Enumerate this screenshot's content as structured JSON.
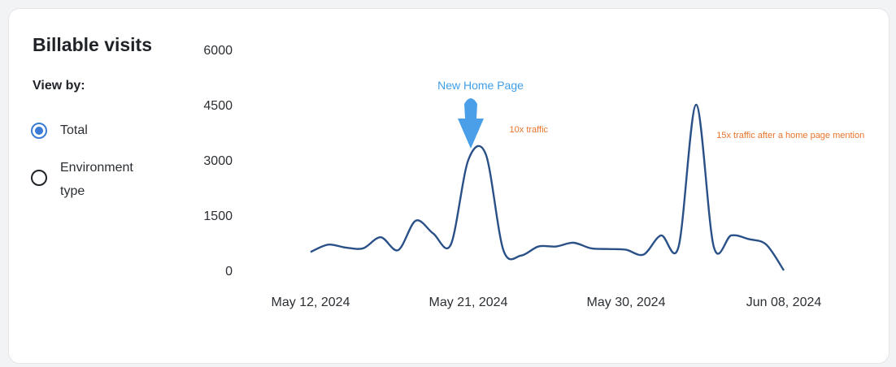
{
  "panel": {
    "title": "Billable visits",
    "view_by_label": "View by:",
    "options": [
      {
        "label": "Total",
        "selected": true
      },
      {
        "label": "Environment\ntype",
        "selected": false
      }
    ]
  },
  "colors": {
    "line": "#2a5088",
    "arrow": "#4a9fe8",
    "home_page_annotation": "#3f9ee8",
    "traffic_annotation": "#e8742c",
    "radio_selected": "#3a7bd5"
  },
  "chart_data": {
    "type": "line",
    "title": "Billable visits",
    "xlabel": "",
    "ylabel": "",
    "ylim": [
      0,
      6000
    ],
    "yticks": [
      0,
      1500,
      3000,
      4500,
      6000
    ],
    "xticks": [
      {
        "value": "2024-05-12",
        "label": "May 12, 2024"
      },
      {
        "value": "2024-05-21",
        "label": "May 21, 2024"
      },
      {
        "value": "2024-05-30",
        "label": "May 30, 2024"
      },
      {
        "value": "2024-06-08",
        "label": "Jun 08, 2024"
      }
    ],
    "grid": false,
    "legend": "none",
    "series": [
      {
        "x": [
          "2024-05-12",
          "2024-05-13",
          "2024-05-14",
          "2024-05-15",
          "2024-05-16",
          "2024-05-17",
          "2024-05-18",
          "2024-05-19",
          "2024-05-20",
          "2024-05-21",
          "2024-05-22",
          "2024-05-23",
          "2024-05-24",
          "2024-05-25",
          "2024-05-26",
          "2024-05-27",
          "2024-05-28",
          "2024-05-29",
          "2024-05-30",
          "2024-05-31",
          "2024-06-01",
          "2024-06-02",
          "2024-06-03",
          "2024-06-04",
          "2024-06-05",
          "2024-06-06",
          "2024-06-07",
          "2024-06-08"
        ],
        "values": [
          500,
          700,
          620,
          600,
          900,
          550,
          1350,
          1000,
          700,
          3000,
          3150,
          550,
          400,
          650,
          650,
          750,
          600,
          580,
          560,
          430,
          950,
          650,
          4500,
          650,
          950,
          850,
          700,
          0
        ]
      }
    ],
    "annotations": [
      {
        "text": "New Home Page",
        "date": "2024-05-21",
        "type": "arrow-label"
      },
      {
        "text": "10x traffic",
        "date": "2024-05-22"
      },
      {
        "text": "15x traffic after a home page mention",
        "date": "2024-06-03"
      }
    ]
  }
}
